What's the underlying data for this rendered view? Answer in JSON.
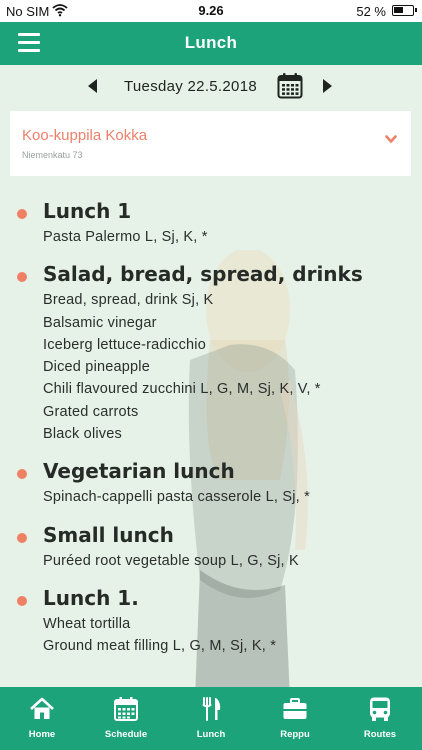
{
  "status_bar": {
    "carrier": "No SIM",
    "time": "9.26",
    "battery": "52 %",
    "battery_level": 0.52,
    "wifi_icon": "wifi-icon"
  },
  "header": {
    "title": "Lunch",
    "menu_icon": "hamburger-menu-icon"
  },
  "date_nav": {
    "date": "Tuesday  22.5.2018",
    "prev_icon": "caret-left-icon",
    "next_icon": "caret-right-icon",
    "calendar_icon": "calendar-icon"
  },
  "restaurant": {
    "name": "Koo-kuppila Kokka",
    "address": "Niemenkatu 73",
    "chevron_icon": "chevron-down-icon"
  },
  "menu": {
    "sections": [
      {
        "title": "Lunch 1",
        "items": [
          "Pasta Palermo L, Sj, K, *"
        ]
      },
      {
        "title": "Salad, bread, spread, drinks",
        "items": [
          "Bread, spread, drink Sj, K",
          "Balsamic vinegar",
          "Iceberg lettuce-radicchio",
          "Diced pineapple",
          "Chili flavoured zucchini L, G, M, Sj, K, V, *",
          "Grated carrots",
          "Black olives"
        ]
      },
      {
        "title": "Vegetarian lunch",
        "items": [
          "Spinach-cappelli pasta casserole L, Sj, *"
        ]
      },
      {
        "title": "Small lunch",
        "items": [
          "Puréed root vegetable soup L, G, Sj, K"
        ]
      },
      {
        "title": "Lunch 1.",
        "items": [
          "Wheat tortilla",
          "Ground meat filling L, G, M, Sj, K, *"
        ]
      }
    ]
  },
  "tabs": [
    {
      "label": "Home",
      "icon": "home-icon"
    },
    {
      "label": "Schedule",
      "icon": "calendar-icon"
    },
    {
      "label": "Lunch",
      "icon": "fork-knife-icon"
    },
    {
      "label": "Reppu",
      "icon": "briefcase-icon"
    },
    {
      "label": "Routes",
      "icon": "bus-icon"
    }
  ],
  "colors": {
    "brand_green": "#1ca37a",
    "accent_coral": "#ef8065",
    "background": "#e6f1e7"
  }
}
